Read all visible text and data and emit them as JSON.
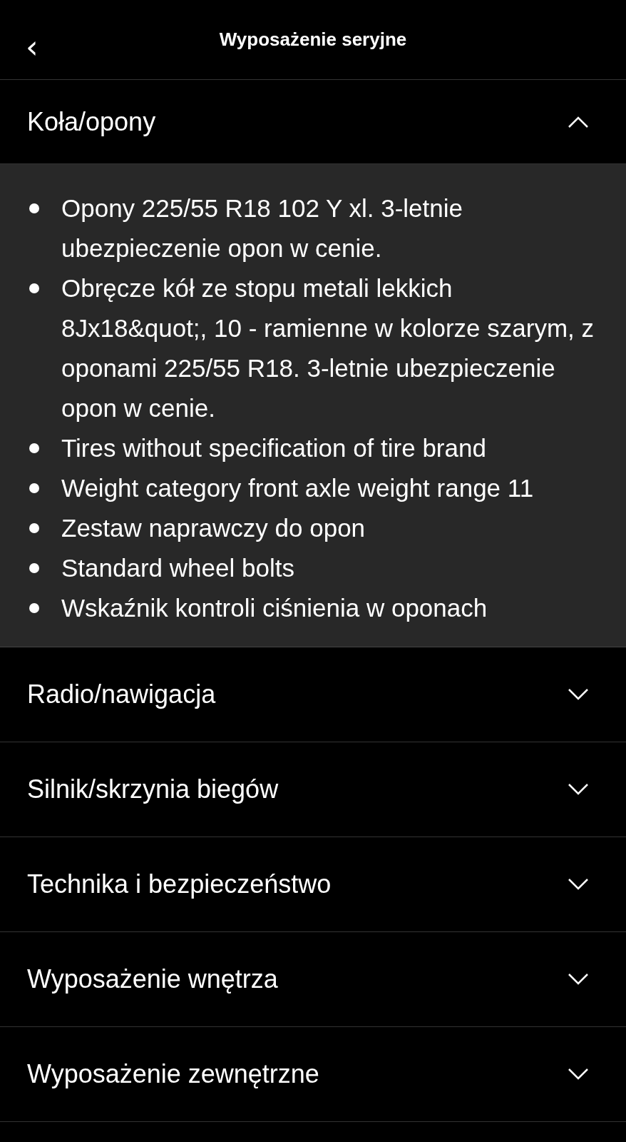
{
  "header": {
    "back_icon": "‹",
    "title": "Wyposażenie seryjne"
  },
  "sections": [
    {
      "title": "Koła/opony",
      "expanded": true,
      "items": [
        "Opony 225/55 R18 102 Y xl. 3-letnie ubezpieczenie opon w cenie.",
        "Obręcze kół ze stopu metali lekkich 8Jx18&quot;, 10 - ramienne w kolorze szarym, z oponami 225/55 R18. 3-letnie ubezpieczenie opon w cenie.",
        "Tires without specification of tire brand",
        "Weight category front axle weight range 11",
        "Zestaw naprawczy do opon",
        "Standard wheel bolts",
        "Wskaźnik kontroli ciśnienia w oponach"
      ]
    },
    {
      "title": "Radio/nawigacja",
      "expanded": false
    },
    {
      "title": "Silnik/skrzynia biegów",
      "expanded": false
    },
    {
      "title": "Technika i bezpieczeństwo",
      "expanded": false
    },
    {
      "title": "Wyposażenie wnętrza",
      "expanded": false
    },
    {
      "title": "Wyposażenie zewnętrzne",
      "expanded": false
    }
  ]
}
